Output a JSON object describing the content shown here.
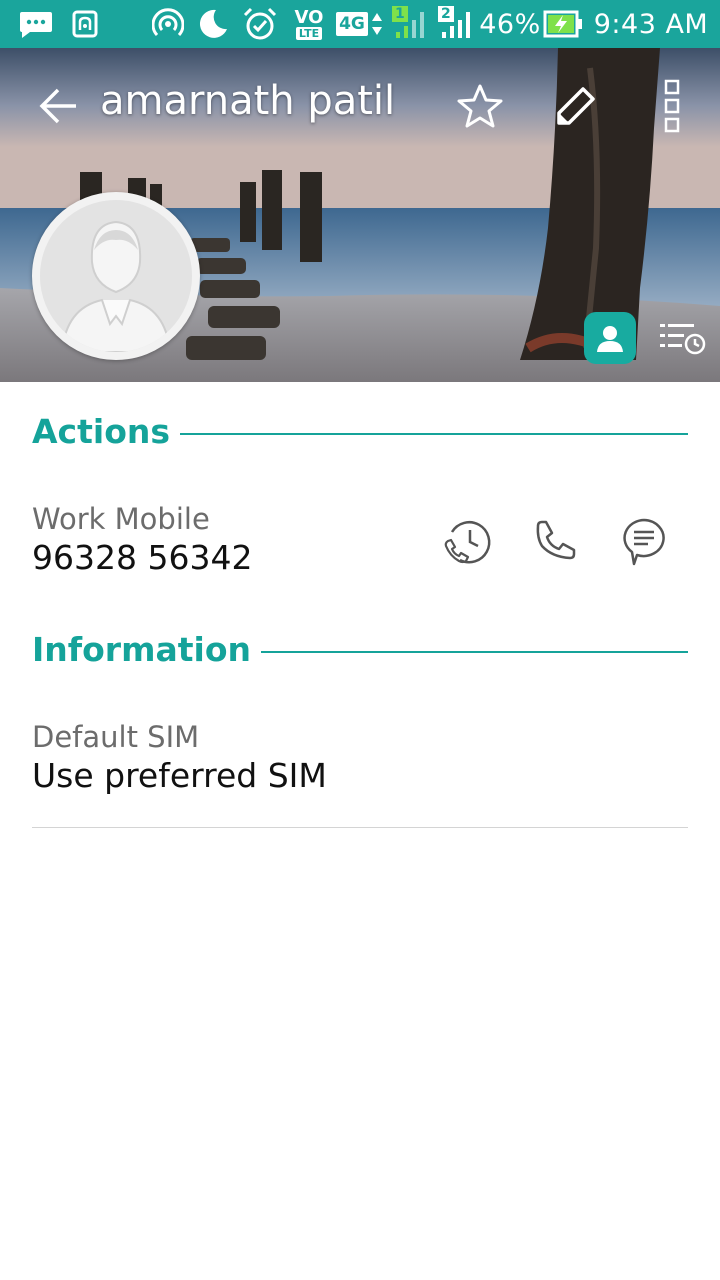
{
  "status_bar": {
    "network_generation": "4G",
    "volte_top": "VO",
    "volte_bottom": "LTE",
    "sim1_label": "1",
    "sim2_label": "2",
    "battery_percent": "46%",
    "time": "9:43 AM",
    "icons": [
      "message-icon",
      "nfc-icon",
      "hotspot-icon",
      "do-not-disturb-icon",
      "alarm-icon",
      "volte-icon",
      "4g-icon",
      "signal-sim1-icon",
      "signal-sim2-icon",
      "battery-charging-icon"
    ]
  },
  "header": {
    "contact_name": "amarnath patil",
    "icons": [
      "back-arrow-icon",
      "star-icon",
      "edit-icon",
      "more-options-icon",
      "contact-card-icon",
      "call-history-icon"
    ]
  },
  "actions": {
    "title": "Actions",
    "phone": {
      "label": "Work Mobile",
      "number": "96328 56342"
    },
    "icons": [
      "call-history-icon",
      "phone-icon",
      "message-icon"
    ]
  },
  "information": {
    "title": "Information",
    "default_sim": {
      "label": "Default SIM",
      "value": "Use preferred SIM"
    }
  },
  "colors": {
    "accent": "#15a39a",
    "status_bar": "#1aa59c"
  }
}
